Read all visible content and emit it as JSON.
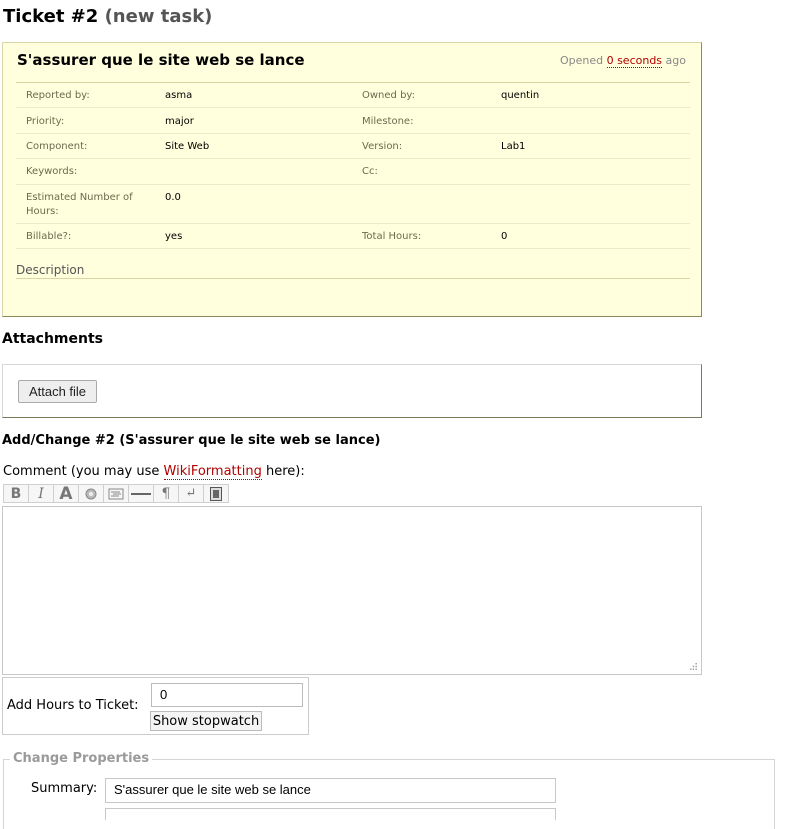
{
  "ticket": {
    "title": "Ticket #2",
    "status": "(new task)",
    "summary": "S'assurer que le site web se lance",
    "opened_prefix": "Opened",
    "opened_link": "0 seconds",
    "opened_suffix": "ago"
  },
  "properties": {
    "reported_by": {
      "label": "Reported by:",
      "value": "asma"
    },
    "owned_by": {
      "label": "Owned by:",
      "value": "quentin"
    },
    "priority": {
      "label": "Priority:",
      "value": "major"
    },
    "milestone": {
      "label": "Milestone:",
      "value": ""
    },
    "component": {
      "label": "Component:",
      "value": "Site Web"
    },
    "version": {
      "label": "Version:",
      "value": "Lab1"
    },
    "keywords": {
      "label": "Keywords:",
      "value": ""
    },
    "cc": {
      "label": "Cc:",
      "value": ""
    },
    "estimated_hours": {
      "label_line1": "Estimated Number of",
      "label_line2": "Hours:",
      "value": "0.0"
    },
    "billable": {
      "label": "Billable?:",
      "value": "yes"
    },
    "total_hours": {
      "label": "Total Hours:",
      "value": "0"
    },
    "description_label": "Description"
  },
  "attachments": {
    "heading": "Attachments",
    "attach_button": "Attach file"
  },
  "add_change": {
    "heading": "Add/Change #2 (S'assurer que le site web se lance)",
    "comment_prefix": "Comment (you may use ",
    "comment_link": "WikiFormatting",
    "comment_suffix": " here):",
    "toolbar": [
      "bold-icon",
      "italic-icon",
      "heading-icon",
      "link-icon",
      "code-block-icon",
      "horizontal-rule-icon",
      "paragraph-icon",
      "line-break-icon",
      "image-icon"
    ],
    "toolbar_glyphs": {
      "bold": "B",
      "italic": "I",
      "heading": "A",
      "paragraph": "¶",
      "line_break": "↵"
    },
    "comment_value": ""
  },
  "hours": {
    "label": "Add Hours to Ticket:",
    "value": "0",
    "stopwatch_button": "Show stopwatch"
  },
  "change_properties": {
    "legend": "Change Properties",
    "summary_label": "Summary:",
    "summary_value": "S'assurer que le site web se lance"
  }
}
